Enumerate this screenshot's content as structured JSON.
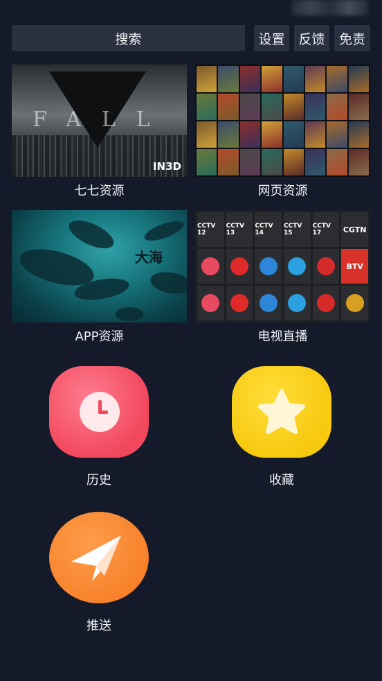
{
  "topbar": {
    "search_label": "搜索",
    "settings_label": "设置",
    "feedback_label": "反馈",
    "free_label": "免责"
  },
  "cards": [
    {
      "label": "七七资源",
      "thumb_text": "FALL",
      "badge": "IN3D"
    },
    {
      "label": "网页资源"
    },
    {
      "label": "APP资源",
      "thumb_text": "大海"
    },
    {
      "label": "电视直播"
    }
  ],
  "tv_channels": [
    "CCTV 12",
    "CCTV 13",
    "CCTV 14",
    "CCTV 15",
    "CCTV 17",
    "CGTN",
    "",
    "",
    "",
    "",
    "",
    "BTV"
  ],
  "shortcuts": [
    {
      "label": "历史",
      "icon": "clock-icon",
      "color": "#f2485e"
    },
    {
      "label": "收藏",
      "icon": "star-icon",
      "color": "#f7c90f"
    },
    {
      "label": "推送",
      "icon": "paper-plane-icon",
      "color": "#f7822b"
    }
  ],
  "colors": {
    "background": "#141a29",
    "button_bg": "#2a3040"
  }
}
